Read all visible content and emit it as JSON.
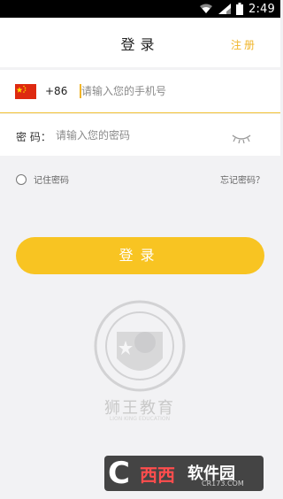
{
  "status_bar": {
    "time": "2:49"
  },
  "header": {
    "title": "登录",
    "register": "注册"
  },
  "phone": {
    "country_code": "+86",
    "placeholder": "请输入您的手机号"
  },
  "password": {
    "label": "密 码：",
    "placeholder": "请输入您的密码"
  },
  "remember": {
    "label": "记住密码"
  },
  "forgot": {
    "label": "忘记密码？"
  },
  "login_button": {
    "label": "登录"
  },
  "watermark": {
    "main": "狮王教育",
    "sub": "LION KING EDUCATION"
  },
  "site_logo": {
    "big": "C",
    "name1": "西西",
    "name2": "软件园",
    "domain": "CR173.COM"
  },
  "colors": {
    "accent": "#f8c422",
    "link": "#f0b52b",
    "background": "#f2f2f4"
  }
}
